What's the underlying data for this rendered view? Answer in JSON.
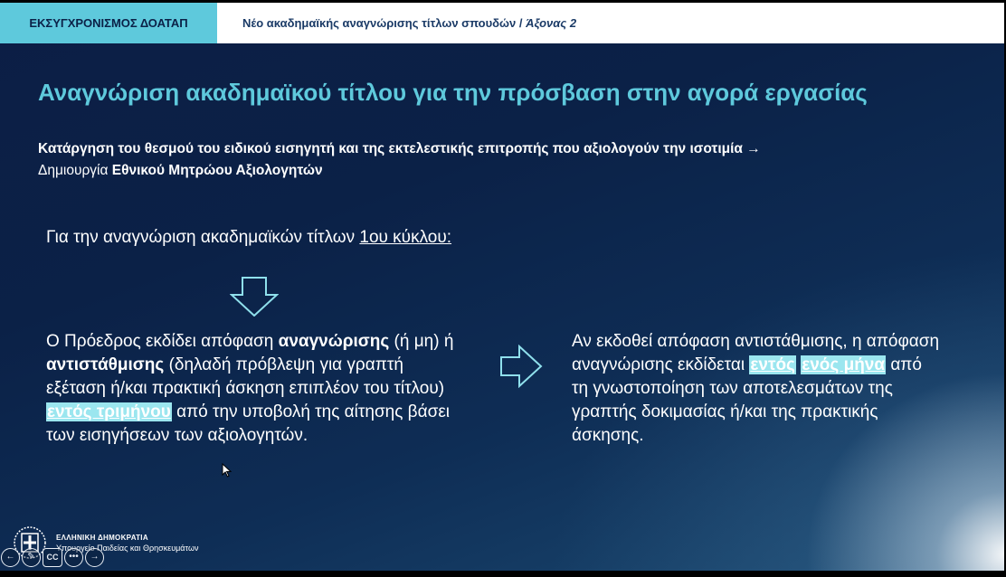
{
  "header": {
    "tag": "ΕΚΣΥΓΧΡΟΝΙΣΜΟΣ ΔΟΑΤΑΠ",
    "subtitle_main": "Νέο ακαδημαϊκής αναγνώρισης τίτλων σπουδών / ",
    "subtitle_italic": "Άξονας 2"
  },
  "title": "Αναγνώριση ακαδημαϊκού τίτλου για την πρόσβαση στην αγορά εργασίας",
  "subtitle": {
    "line1": "Κατάργηση του θεσμού του ειδικού εισηγητή και της εκτελεστικής επιτροπής που αξιολογούν την ισοτιμία →",
    "line2_normal": "Δημιουργία ",
    "line2_bold": "Εθνικού Μητρώου Αξιολογητών"
  },
  "intro": {
    "text": "Για την αναγνώριση ακαδημαϊκών τίτλων ",
    "underlined": "1ου κύκλου:"
  },
  "left": {
    "p1": "Ο Πρόεδρος εκδίδει απόφαση ",
    "b1": "αναγνώρισης",
    "p2": " (ή μη) ή ",
    "b2": "αντιστάθμισης",
    "p3": " (δηλαδή πρόβλεψη για γραπτή εξέταση  ή/και πρακτική άσκηση επιπλέον του τίτλου) ",
    "highlight": "εντός τριμήνου",
    "p4": " από την υποβολή της αίτησης βάσει των εισηγήσεων των αξιολογητών."
  },
  "right": {
    "p1": "Αν εκδοθεί απόφαση αντιστάθμισης, η απόφαση αναγνώρισης εκδίδεται ",
    "highlight1": "εντός",
    "space": " ",
    "highlight2": "ενός μήνα",
    "p2": " από τη γνωστοποίηση των αποτελεσμάτων της γραπτής δοκιμασίας ή/και της πρακτικής άσκησης."
  },
  "footer": {
    "line1": "ΕΛΛΗΝΙΚΗ ΔΗΜΟΚΡΑΤΙΑ",
    "line2": "Υπουργείο Παιδείας και Θρησκευμάτων"
  },
  "controls": {
    "prev": "←",
    "pen": "✎",
    "cc": "CC",
    "more": "•••",
    "next": "→"
  },
  "colors": {
    "accent": "#5ec9dc",
    "highlight": "#9be6ef",
    "background": "#0b2147"
  }
}
